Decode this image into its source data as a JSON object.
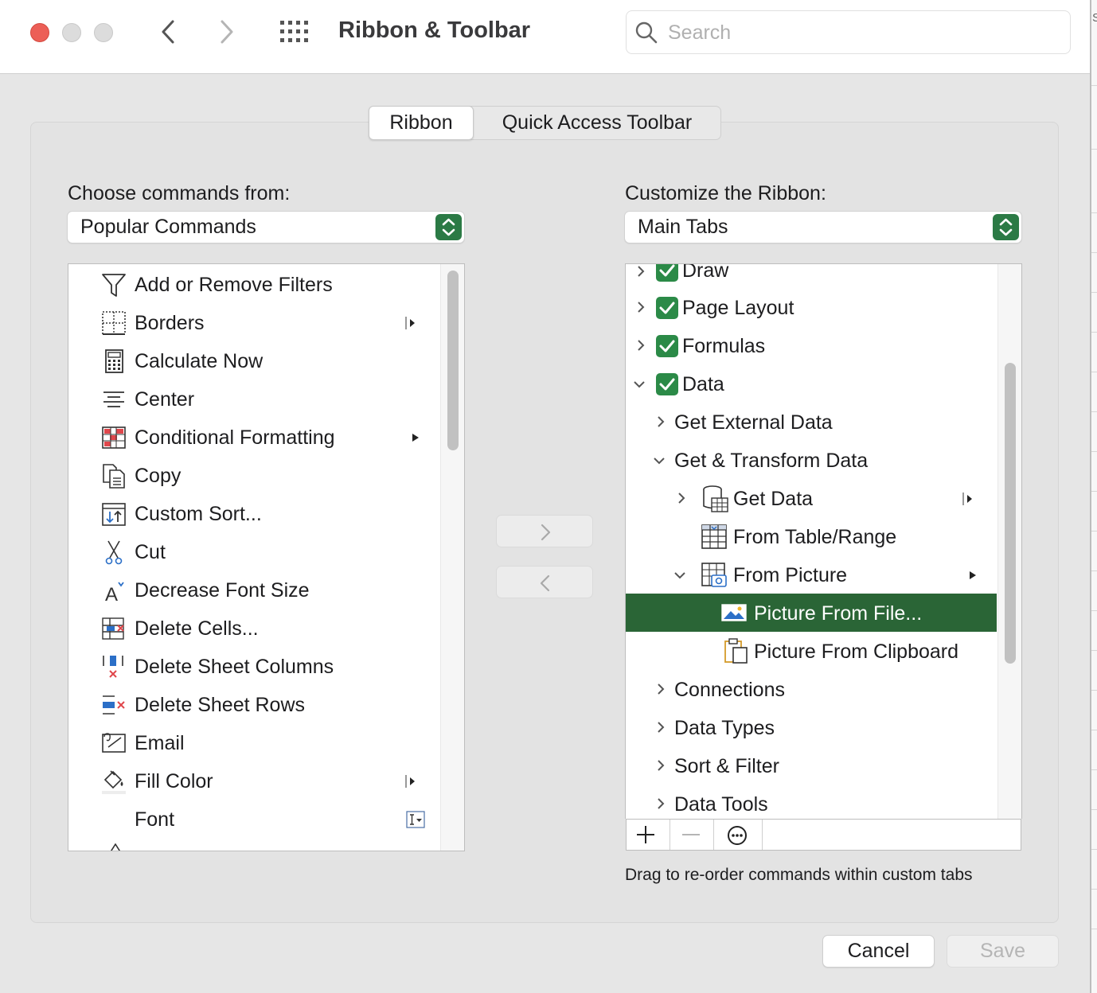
{
  "window": {
    "title": "Ribbon & Toolbar",
    "search_placeholder": "Search"
  },
  "tabs": [
    {
      "label": "Ribbon",
      "active": true
    },
    {
      "label": "Quick Access Toolbar",
      "active": false
    }
  ],
  "left": {
    "label": "Choose commands from:",
    "dropdown_value": "Popular Commands",
    "commands": [
      {
        "label": "Add or Remove Filters",
        "icon": "filter-icon",
        "submenu": false
      },
      {
        "label": "Borders",
        "icon": "borders-icon",
        "submenu": true,
        "split": true
      },
      {
        "label": "Calculate Now",
        "icon": "calculator-icon",
        "submenu": false
      },
      {
        "label": "Center",
        "icon": "align-center-icon",
        "submenu": false
      },
      {
        "label": "Conditional Formatting",
        "icon": "conditional-formatting-icon",
        "submenu": true
      },
      {
        "label": "Copy",
        "icon": "copy-icon",
        "submenu": false
      },
      {
        "label": "Custom Sort...",
        "icon": "custom-sort-icon",
        "submenu": false
      },
      {
        "label": "Cut",
        "icon": "scissors-icon",
        "submenu": false
      },
      {
        "label": "Decrease Font Size",
        "icon": "decrease-font-icon",
        "submenu": false
      },
      {
        "label": "Delete Cells...",
        "icon": "delete-cells-icon",
        "submenu": false
      },
      {
        "label": "Delete Sheet Columns",
        "icon": "delete-columns-icon",
        "submenu": false
      },
      {
        "label": "Delete Sheet Rows",
        "icon": "delete-rows-icon",
        "submenu": false
      },
      {
        "label": "Email",
        "icon": "email-icon",
        "submenu": false
      },
      {
        "label": "Fill Color",
        "icon": "fill-color-icon",
        "submenu": true,
        "split": true
      },
      {
        "label": "Font",
        "icon": "",
        "submenu": false,
        "font_control": true
      }
    ]
  },
  "right": {
    "label": "Customize the Ribbon:",
    "dropdown_value": "Main Tabs",
    "tree": [
      {
        "label": "Draw",
        "level": 0,
        "expand": "collapsed",
        "checked": true
      },
      {
        "label": "Page Layout",
        "level": 0,
        "expand": "collapsed",
        "checked": true
      },
      {
        "label": "Formulas",
        "level": 0,
        "expand": "collapsed",
        "checked": true
      },
      {
        "label": "Data",
        "level": 0,
        "expand": "expanded",
        "checked": true
      },
      {
        "label": "Get External Data",
        "level": 1,
        "expand": "collapsed"
      },
      {
        "label": "Get & Transform Data",
        "level": 1,
        "expand": "expanded"
      },
      {
        "label": "Get Data",
        "level": 2,
        "expand": "collapsed",
        "icon": "database-icon",
        "submenu": true,
        "split": true
      },
      {
        "label": "From Table/Range",
        "level": 2,
        "expand": "none",
        "icon": "table-icon"
      },
      {
        "label": "From Picture",
        "level": 2,
        "expand": "expanded",
        "icon": "picture-table-icon",
        "submenu": true
      },
      {
        "label": "Picture From File...",
        "level": 3,
        "expand": "none",
        "icon": "image-icon",
        "selected": true
      },
      {
        "label": "Picture From Clipboard",
        "level": 3,
        "expand": "none",
        "icon": "clipboard-icon"
      },
      {
        "label": "Connections",
        "level": 1,
        "expand": "collapsed"
      },
      {
        "label": "Data Types",
        "level": 1,
        "expand": "collapsed"
      },
      {
        "label": "Sort & Filter",
        "level": 1,
        "expand": "collapsed"
      },
      {
        "label": "Data Tools",
        "level": 1,
        "expand": "collapsed"
      }
    ],
    "toolbar": [
      "plus-icon",
      "minus-icon",
      "more-icon"
    ],
    "hint": "Drag to re-order commands within custom tabs"
  },
  "buttons": {
    "cancel": "Cancel",
    "save": "Save"
  },
  "colors": {
    "accent_green": "#2b8a47",
    "selected_row": "#2a6536",
    "close_red": "#ec5f57"
  }
}
